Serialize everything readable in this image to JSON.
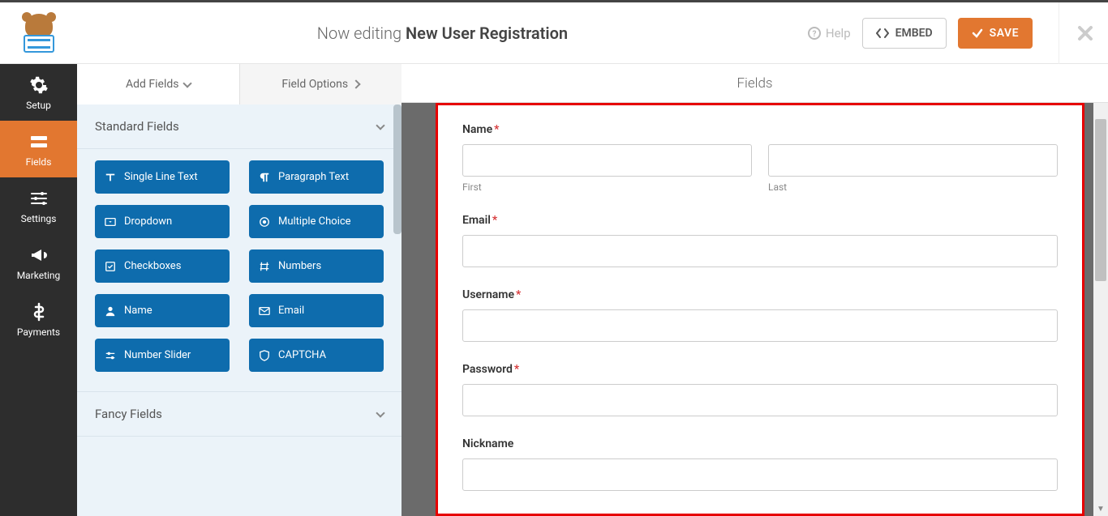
{
  "topbar": {
    "editing_prefix": "Now editing ",
    "form_name": "New User Registration",
    "help": "Help",
    "embed": "EMBED",
    "save": "SAVE"
  },
  "sidenav": {
    "setup": "Setup",
    "fields": "Fields",
    "settings": "Settings",
    "marketing": "Marketing",
    "payments": "Payments"
  },
  "panel": {
    "tab_add": "Add Fields",
    "tab_options": "Field Options",
    "section_standard": "Standard Fields",
    "section_fancy": "Fancy Fields",
    "buttons": {
      "single_line": "Single Line Text",
      "paragraph": "Paragraph Text",
      "dropdown": "Dropdown",
      "multiple_choice": "Multiple Choice",
      "checkboxes": "Checkboxes",
      "numbers": "Numbers",
      "name": "Name",
      "email": "Email",
      "number_slider": "Number Slider",
      "captcha": "CAPTCHA"
    }
  },
  "main": {
    "header": "Fields",
    "fields": {
      "name_label": "Name",
      "first_sub": "First",
      "last_sub": "Last",
      "email_label": "Email",
      "username_label": "Username",
      "password_label": "Password",
      "nickname_label": "Nickname"
    }
  }
}
